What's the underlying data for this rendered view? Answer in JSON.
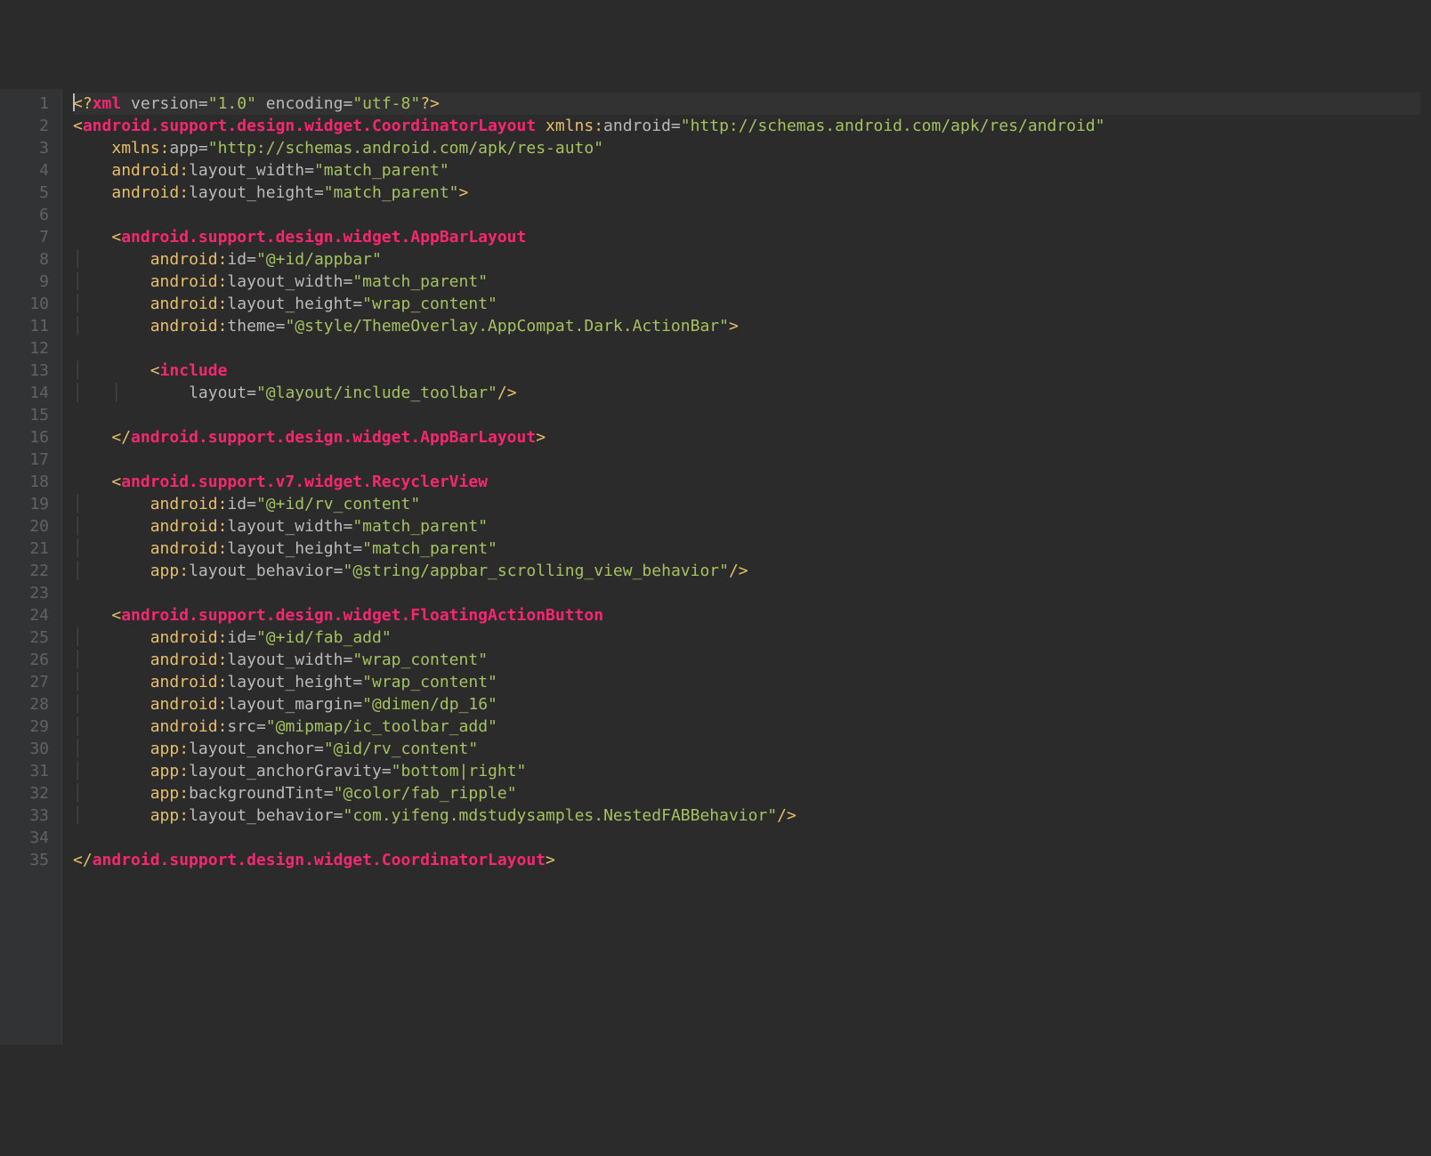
{
  "colors": {
    "background": "#2b2b2b",
    "gutter_bg": "#313335",
    "gutter_fg": "#606366",
    "tag": "#e8bf6a",
    "attr": "#bababa",
    "string": "#a5c261",
    "pink": "#f92672",
    "guide": "#444444"
  },
  "line_count": 35,
  "cursor_line": 1,
  "code_lines": [
    {
      "n": 1,
      "indent": 0,
      "segs": [
        {
          "cls": "punc",
          "t": "<?"
        },
        {
          "cls": "pink",
          "t": "xml "
        },
        {
          "cls": "attr",
          "t": "version"
        },
        {
          "cls": "eq",
          "t": "="
        },
        {
          "cls": "str",
          "t": "\"1.0\""
        },
        {
          "cls": "attr",
          "t": " "
        },
        {
          "cls": "attr",
          "t": "encoding"
        },
        {
          "cls": "eq",
          "t": "="
        },
        {
          "cls": "str",
          "t": "\"utf-8\""
        },
        {
          "cls": "punc",
          "t": "?>"
        }
      ]
    },
    {
      "n": 2,
      "indent": 0,
      "segs": [
        {
          "cls": "punc",
          "t": "<"
        },
        {
          "cls": "pink",
          "t": "android.support.design.widget.CoordinatorLayout "
        },
        {
          "cls": "tag",
          "t": "xmlns:"
        },
        {
          "cls": "attr",
          "t": "android"
        },
        {
          "cls": "eq",
          "t": "="
        },
        {
          "cls": "str",
          "t": "\"http://schemas.android.com/apk/res/android\""
        }
      ]
    },
    {
      "n": 3,
      "indent": 4,
      "segs": [
        {
          "cls": "tag",
          "t": "xmlns:"
        },
        {
          "cls": "attr",
          "t": "app"
        },
        {
          "cls": "eq",
          "t": "="
        },
        {
          "cls": "str",
          "t": "\"http://schemas.android.com/apk/res-auto\""
        }
      ]
    },
    {
      "n": 4,
      "indent": 4,
      "segs": [
        {
          "cls": "tag",
          "t": "android:"
        },
        {
          "cls": "attr",
          "t": "layout_width"
        },
        {
          "cls": "eq",
          "t": "="
        },
        {
          "cls": "str",
          "t": "\"match_parent\""
        }
      ]
    },
    {
      "n": 5,
      "indent": 4,
      "segs": [
        {
          "cls": "tag",
          "t": "android:"
        },
        {
          "cls": "attr",
          "t": "layout_height"
        },
        {
          "cls": "eq",
          "t": "="
        },
        {
          "cls": "str",
          "t": "\"match_parent\""
        },
        {
          "cls": "punc",
          "t": ">"
        }
      ]
    },
    {
      "n": 6,
      "indent": 0,
      "segs": []
    },
    {
      "n": 7,
      "indent": 4,
      "segs": [
        {
          "cls": "punc",
          "t": "<"
        },
        {
          "cls": "pink",
          "t": "android.support.design.widget.AppBarLayout"
        }
      ]
    },
    {
      "n": 8,
      "indent": 8,
      "guides": 1,
      "segs": [
        {
          "cls": "tag",
          "t": "android:"
        },
        {
          "cls": "attr",
          "t": "id"
        },
        {
          "cls": "eq",
          "t": "="
        },
        {
          "cls": "str",
          "t": "\"@+id/appbar\""
        }
      ]
    },
    {
      "n": 9,
      "indent": 8,
      "guides": 1,
      "segs": [
        {
          "cls": "tag",
          "t": "android:"
        },
        {
          "cls": "attr",
          "t": "layout_width"
        },
        {
          "cls": "eq",
          "t": "="
        },
        {
          "cls": "str",
          "t": "\"match_parent\""
        }
      ]
    },
    {
      "n": 10,
      "indent": 8,
      "guides": 1,
      "segs": [
        {
          "cls": "tag",
          "t": "android:"
        },
        {
          "cls": "attr",
          "t": "layout_height"
        },
        {
          "cls": "eq",
          "t": "="
        },
        {
          "cls": "str",
          "t": "\"wrap_content\""
        }
      ]
    },
    {
      "n": 11,
      "indent": 8,
      "guides": 1,
      "segs": [
        {
          "cls": "tag",
          "t": "android:"
        },
        {
          "cls": "attr",
          "t": "theme"
        },
        {
          "cls": "eq",
          "t": "="
        },
        {
          "cls": "str",
          "t": "\"@style/ThemeOverlay.AppCompat.Dark.ActionBar\""
        },
        {
          "cls": "punc",
          "t": ">"
        }
      ]
    },
    {
      "n": 12,
      "indent": 0,
      "guides": 1,
      "segs": []
    },
    {
      "n": 13,
      "indent": 8,
      "guides": 1,
      "segs": [
        {
          "cls": "punc",
          "t": "<"
        },
        {
          "cls": "pink",
          "t": "include"
        }
      ]
    },
    {
      "n": 14,
      "indent": 12,
      "guides": 2,
      "segs": [
        {
          "cls": "attr",
          "t": "layout"
        },
        {
          "cls": "eq",
          "t": "="
        },
        {
          "cls": "str",
          "t": "\"@layout/include_toolbar\""
        },
        {
          "cls": "punc",
          "t": "/>"
        }
      ]
    },
    {
      "n": 15,
      "indent": 0,
      "segs": []
    },
    {
      "n": 16,
      "indent": 4,
      "segs": [
        {
          "cls": "punc",
          "t": "</"
        },
        {
          "cls": "pink",
          "t": "android.support.design.widget.AppBarLayout"
        },
        {
          "cls": "punc",
          "t": ">"
        }
      ]
    },
    {
      "n": 17,
      "indent": 0,
      "segs": []
    },
    {
      "n": 18,
      "indent": 4,
      "segs": [
        {
          "cls": "punc",
          "t": "<"
        },
        {
          "cls": "pink",
          "t": "android.support.v7.widget.RecyclerView"
        }
      ]
    },
    {
      "n": 19,
      "indent": 8,
      "guides": 1,
      "segs": [
        {
          "cls": "tag",
          "t": "android:"
        },
        {
          "cls": "attr",
          "t": "id"
        },
        {
          "cls": "eq",
          "t": "="
        },
        {
          "cls": "str",
          "t": "\"@+id/rv_content\""
        }
      ]
    },
    {
      "n": 20,
      "indent": 8,
      "guides": 1,
      "segs": [
        {
          "cls": "tag",
          "t": "android:"
        },
        {
          "cls": "attr",
          "t": "layout_width"
        },
        {
          "cls": "eq",
          "t": "="
        },
        {
          "cls": "str",
          "t": "\"match_parent\""
        }
      ]
    },
    {
      "n": 21,
      "indent": 8,
      "guides": 1,
      "segs": [
        {
          "cls": "tag",
          "t": "android:"
        },
        {
          "cls": "attr",
          "t": "layout_height"
        },
        {
          "cls": "eq",
          "t": "="
        },
        {
          "cls": "str",
          "t": "\"match_parent\""
        }
      ]
    },
    {
      "n": 22,
      "indent": 8,
      "guides": 1,
      "segs": [
        {
          "cls": "tag",
          "t": "app:"
        },
        {
          "cls": "attr",
          "t": "layout_behavior"
        },
        {
          "cls": "eq",
          "t": "="
        },
        {
          "cls": "str",
          "t": "\"@string/appbar_scrolling_view_behavior\""
        },
        {
          "cls": "punc",
          "t": "/>"
        }
      ]
    },
    {
      "n": 23,
      "indent": 0,
      "segs": []
    },
    {
      "n": 24,
      "indent": 4,
      "segs": [
        {
          "cls": "punc",
          "t": "<"
        },
        {
          "cls": "pink",
          "t": "android.support.design.widget.FloatingActionButton"
        }
      ]
    },
    {
      "n": 25,
      "indent": 8,
      "guides": 1,
      "segs": [
        {
          "cls": "tag",
          "t": "android:"
        },
        {
          "cls": "attr",
          "t": "id"
        },
        {
          "cls": "eq",
          "t": "="
        },
        {
          "cls": "str",
          "t": "\"@+id/fab_add\""
        }
      ]
    },
    {
      "n": 26,
      "indent": 8,
      "guides": 1,
      "segs": [
        {
          "cls": "tag",
          "t": "android:"
        },
        {
          "cls": "attr",
          "t": "layout_width"
        },
        {
          "cls": "eq",
          "t": "="
        },
        {
          "cls": "str",
          "t": "\"wrap_content\""
        }
      ]
    },
    {
      "n": 27,
      "indent": 8,
      "guides": 1,
      "segs": [
        {
          "cls": "tag",
          "t": "android:"
        },
        {
          "cls": "attr",
          "t": "layout_height"
        },
        {
          "cls": "eq",
          "t": "="
        },
        {
          "cls": "str",
          "t": "\"wrap_content\""
        }
      ]
    },
    {
      "n": 28,
      "indent": 8,
      "guides": 1,
      "segs": [
        {
          "cls": "tag",
          "t": "android:"
        },
        {
          "cls": "attr",
          "t": "layout_margin"
        },
        {
          "cls": "eq",
          "t": "="
        },
        {
          "cls": "str",
          "t": "\"@dimen/dp_16\""
        }
      ]
    },
    {
      "n": 29,
      "indent": 8,
      "guides": 1,
      "segs": [
        {
          "cls": "tag",
          "t": "android:"
        },
        {
          "cls": "attr",
          "t": "src"
        },
        {
          "cls": "eq",
          "t": "="
        },
        {
          "cls": "str",
          "t": "\"@mipmap/ic_toolbar_add\""
        }
      ]
    },
    {
      "n": 30,
      "indent": 8,
      "guides": 1,
      "segs": [
        {
          "cls": "tag",
          "t": "app:"
        },
        {
          "cls": "attr",
          "t": "layout_anchor"
        },
        {
          "cls": "eq",
          "t": "="
        },
        {
          "cls": "str",
          "t": "\"@id/rv_content\""
        }
      ]
    },
    {
      "n": 31,
      "indent": 8,
      "guides": 1,
      "segs": [
        {
          "cls": "tag",
          "t": "app:"
        },
        {
          "cls": "attr",
          "t": "layout_anchorGravity"
        },
        {
          "cls": "eq",
          "t": "="
        },
        {
          "cls": "str",
          "t": "\"bottom|right\""
        }
      ]
    },
    {
      "n": 32,
      "indent": 8,
      "guides": 1,
      "segs": [
        {
          "cls": "tag",
          "t": "app:"
        },
        {
          "cls": "attr",
          "t": "backgroundTint"
        },
        {
          "cls": "eq",
          "t": "="
        },
        {
          "cls": "str",
          "t": "\"@color/fab_ripple\""
        }
      ]
    },
    {
      "n": 33,
      "indent": 8,
      "guides": 1,
      "segs": [
        {
          "cls": "tag",
          "t": "app:"
        },
        {
          "cls": "attr",
          "t": "layout_behavior"
        },
        {
          "cls": "eq",
          "t": "="
        },
        {
          "cls": "str",
          "t": "\"com.yifeng.mdstudysamples.NestedFABBehavior\""
        },
        {
          "cls": "punc",
          "t": "/>"
        }
      ]
    },
    {
      "n": 34,
      "indent": 0,
      "segs": []
    },
    {
      "n": 35,
      "indent": 0,
      "segs": [
        {
          "cls": "punc",
          "t": "</"
        },
        {
          "cls": "pink",
          "t": "android.support.design.widget.CoordinatorLayout"
        },
        {
          "cls": "punc",
          "t": ">"
        }
      ]
    }
  ]
}
